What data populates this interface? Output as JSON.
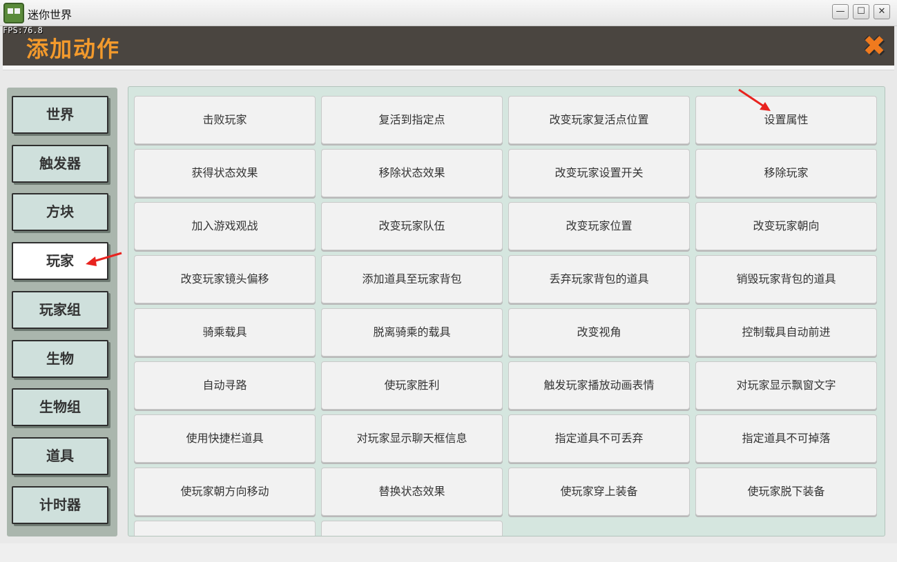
{
  "window": {
    "title": "迷你世界",
    "minimize_symbol": "—",
    "maximize_symbol": "☐",
    "close_symbol": "✕"
  },
  "fps": "FPS:76.8",
  "header": {
    "title": "添加动作",
    "close_symbol": "✖"
  },
  "tabs": [
    {
      "label": "世界",
      "active": false
    },
    {
      "label": "触发器",
      "active": false
    },
    {
      "label": "方块",
      "active": false
    },
    {
      "label": "玩家",
      "active": true
    },
    {
      "label": "玩家组",
      "active": false
    },
    {
      "label": "生物",
      "active": false
    },
    {
      "label": "生物组",
      "active": false
    },
    {
      "label": "道具",
      "active": false
    },
    {
      "label": "计时器",
      "active": false
    }
  ],
  "actions": [
    "击败玩家",
    "复活到指定点",
    "改变玩家复活点位置",
    "设置属性",
    "获得状态效果",
    "移除状态效果",
    "改变玩家设置开关",
    "移除玩家",
    "加入游戏观战",
    "改变玩家队伍",
    "改变玩家位置",
    "改变玩家朝向",
    "改变玩家镜头偏移",
    "添加道具至玩家背包",
    "丢弃玩家背包的道具",
    "销毁玩家背包的道具",
    "骑乘载具",
    "脱离骑乘的载具",
    "改变视角",
    "控制载具自动前进",
    "自动寻路",
    "使玩家胜利",
    "触发玩家播放动画表情",
    "对玩家显示飘窗文字",
    "使用快捷栏道具",
    "对玩家显示聊天框信息",
    "指定道具不可丢弃",
    "指定道具不可掉落",
    "使玩家朝方向移动",
    "替换状态效果",
    "使玩家穿上装备",
    "使玩家脱下装备",
    "",
    ""
  ],
  "annotation_color": "#e8231f"
}
